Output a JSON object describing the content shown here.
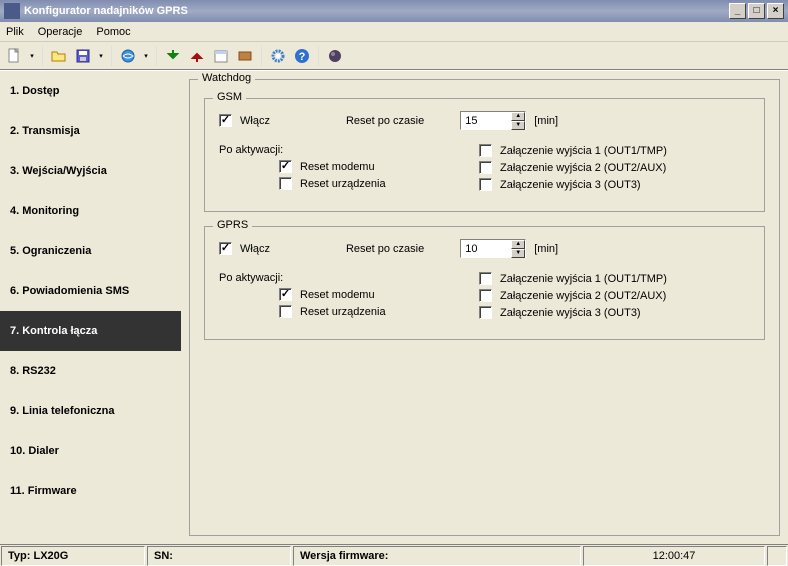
{
  "window": {
    "title": "Konfigurator nadajników GPRS",
    "min": "_",
    "max": "☐",
    "close": "✕"
  },
  "menu": {
    "file": "Plik",
    "operations": "Operacje",
    "help": "Pomoc"
  },
  "sidebar": {
    "items": [
      {
        "label": "1. Dostęp"
      },
      {
        "label": "2. Transmisja"
      },
      {
        "label": "3. Wejścia/Wyjścia"
      },
      {
        "label": "4. Monitoring"
      },
      {
        "label": "5. Ograniczenia"
      },
      {
        "label": "6. Powiadomienia SMS"
      },
      {
        "label": "7. Kontrola łącza"
      },
      {
        "label": "8. RS232"
      },
      {
        "label": "9. Linia telefoniczna"
      },
      {
        "label": "10. Dialer"
      },
      {
        "label": "11. Firmware"
      }
    ],
    "selected_index": 6
  },
  "panel": {
    "watchdog": "Watchdog",
    "gsm": {
      "legend": "GSM",
      "enable": "Włącz",
      "reset_label": "Reset po czasie",
      "reset_value": "15",
      "unit": "[min]",
      "after_activation": "Po aktywacji:",
      "reset_modem": "Reset modemu",
      "reset_device": "Reset urządzenia",
      "out1": "Załączenie wyjścia 1 (OUT1/TMP)",
      "out2": "Załączenie wyjścia 2 (OUT2/AUX)",
      "out3": "Załączenie wyjścia 3 (OUT3)"
    },
    "gprs": {
      "legend": "GPRS",
      "enable": "Włącz",
      "reset_label": "Reset po czasie",
      "reset_value": "10",
      "unit": "[min]",
      "after_activation": "Po aktywacji:",
      "reset_modem": "Reset modemu",
      "reset_device": "Reset urządzenia",
      "out1": "Załączenie wyjścia 1 (OUT1/TMP)",
      "out2": "Załączenie wyjścia 2 (OUT2/AUX)",
      "out3": "Załączenie wyjścia 3 (OUT3)"
    }
  },
  "status": {
    "type_label": "Typ:",
    "type_value": "LX20G",
    "sn": "SN:",
    "fw": "Wersja firmware:",
    "time": "12:00:47"
  }
}
